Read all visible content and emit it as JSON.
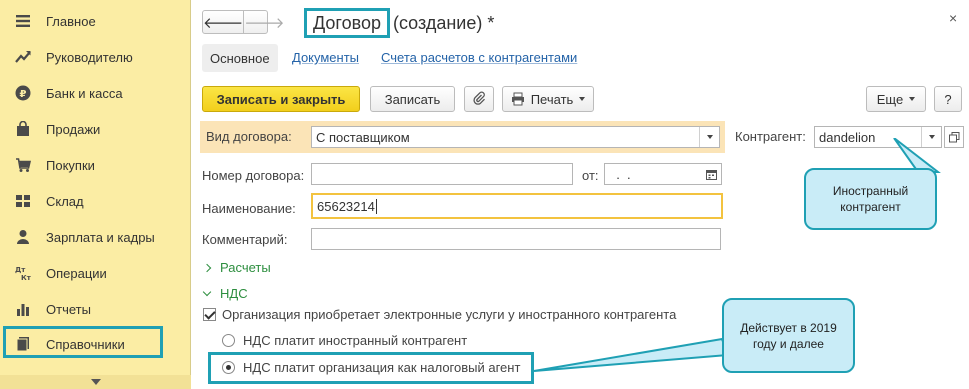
{
  "sidebar": {
    "items": [
      {
        "label": "Главное",
        "icon": "menu-icon"
      },
      {
        "label": "Руководителю",
        "icon": "trend-icon"
      },
      {
        "label": "Банк и касса",
        "icon": "ruble-icon"
      },
      {
        "label": "Продажи",
        "icon": "bag-icon"
      },
      {
        "label": "Покупки",
        "icon": "cart-icon"
      },
      {
        "label": "Склад",
        "icon": "warehouse-icon"
      },
      {
        "label": "Зарплата и кадры",
        "icon": "person-icon"
      },
      {
        "label": "Операции",
        "icon": "dt-kt-icon"
      },
      {
        "label": "Отчеты",
        "icon": "bar-chart-icon"
      },
      {
        "label": "Справочники",
        "icon": "book-icon"
      }
    ],
    "active_index": 9
  },
  "header": {
    "title_main": "Договор",
    "title_rest": "(создание) *",
    "back_glyph": "🡐",
    "forward_glyph": "🡒",
    "close_glyph": "×"
  },
  "tabs": {
    "main": "Основное",
    "documents": "Документы",
    "accounts": "Счета расчетов с контрагентами"
  },
  "toolbar": {
    "save_close": "Записать и закрыть",
    "save": "Записать",
    "print": "Печать",
    "more": "Еще",
    "help": "?"
  },
  "form": {
    "contract_type_label": "Вид договора:",
    "contract_type_value": "С поставщиком",
    "counterparty_label": "Контрагент:",
    "counterparty_value": "dandelion",
    "number_label": "Номер договора:",
    "number_value": "",
    "date_label": "от:",
    "date_value": "  .  .",
    "name_label": "Наименование:",
    "name_value": "65623214",
    "comment_label": "Комментарий:",
    "comment_value": ""
  },
  "sections": {
    "payments": "Расчеты",
    "vat": "НДС"
  },
  "vat": {
    "checkbox_label": "Организация приобретает электронные услуги у иностранного контрагента",
    "checked": true,
    "option_foreign": "НДС платит иностранный контрагент",
    "option_agent": "НДС платит организация как налоговый агент",
    "selected": "option_agent"
  },
  "callouts": {
    "foreign": "Иностранный контрагент",
    "since": "Действует в 2019 году и далее"
  },
  "colors": {
    "sidebar_bg": "#fbeda4",
    "highlight": "#1fa0b4",
    "primary_button": "#f2cf1c",
    "link": "#2463a8",
    "section_green": "#2d8e3f",
    "callout_fill": "#c9ecf7"
  }
}
